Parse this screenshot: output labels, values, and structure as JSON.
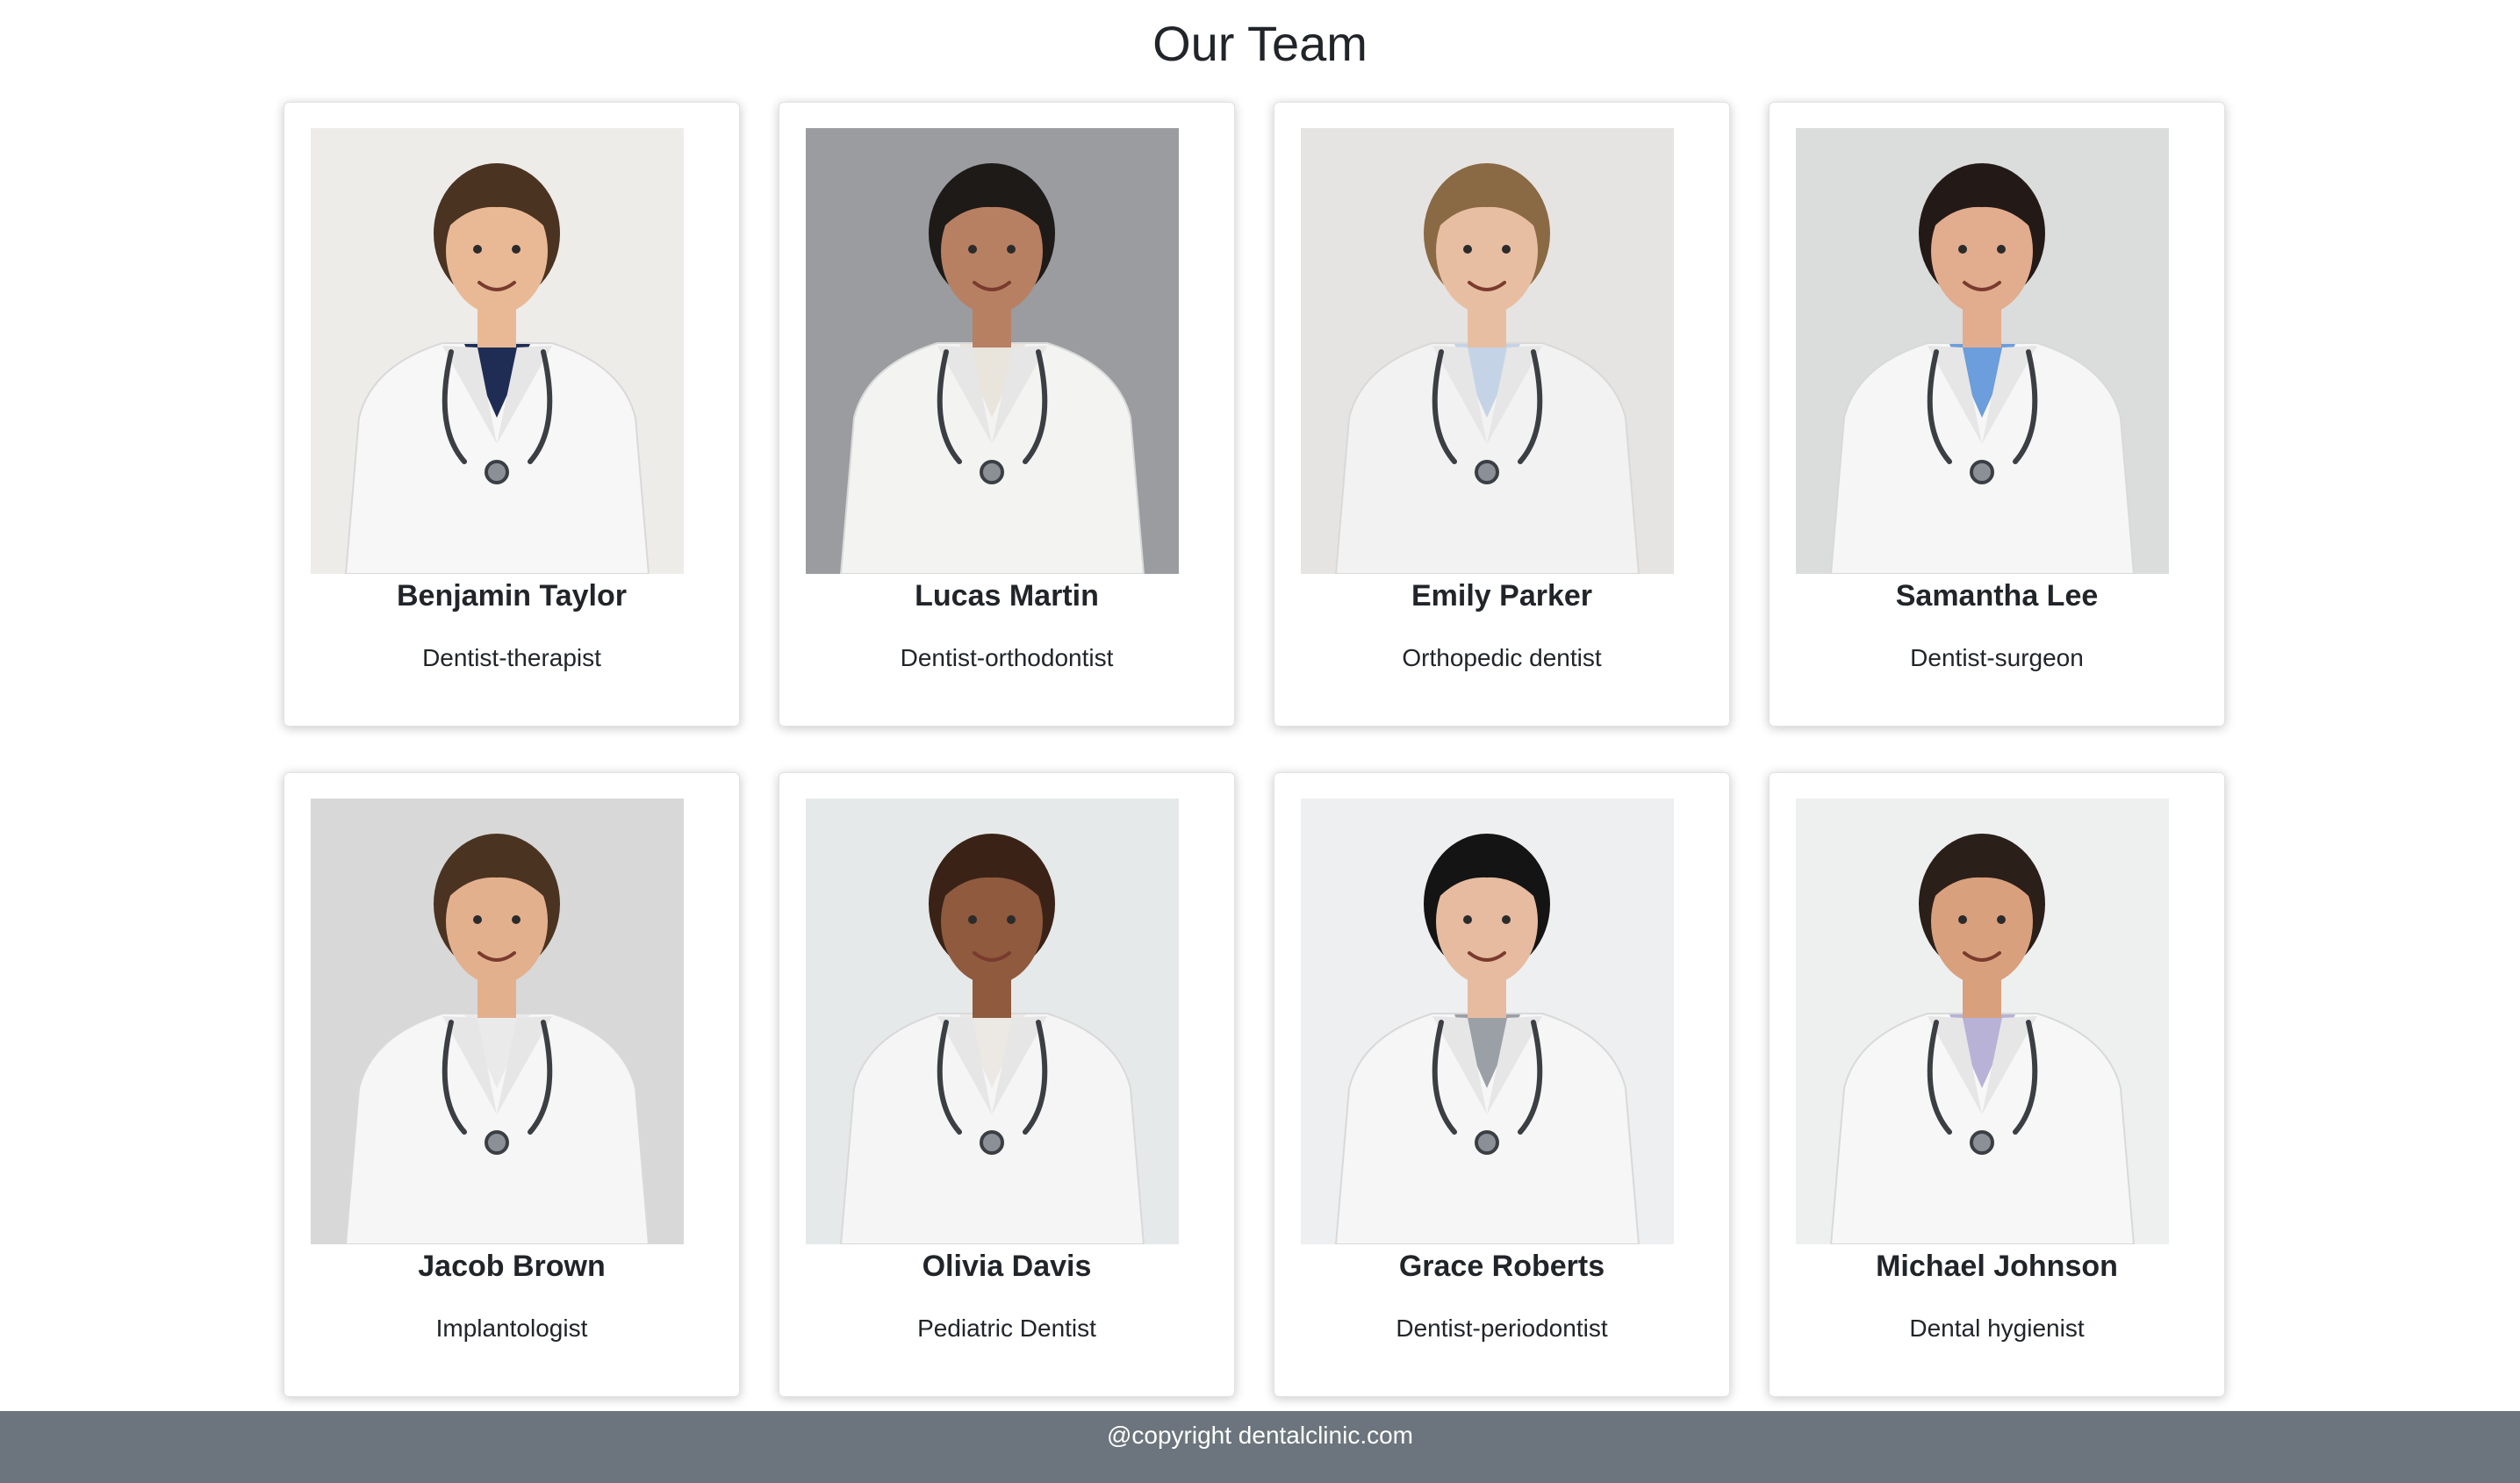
{
  "page": {
    "title": "Our Team"
  },
  "team": [
    {
      "name": "Benjamin Taylor",
      "role": "Dentist-therapist",
      "photo": "doctor-portrait-photo",
      "bg": "#eceae6",
      "skin": "#e9b996",
      "hair": "#4a3321",
      "coat": "#f7f7f7",
      "accent": "#1f2d55"
    },
    {
      "name": "Lucas Martin",
      "role": "Dentist-orthodontist",
      "photo": "doctor-portrait-photo",
      "bg": "#8c8f93",
      "skin": "#b88062",
      "hair": "#1d1a18",
      "coat": "#f3f3f1",
      "accent": "#e9e4dc"
    },
    {
      "name": "Emily Parker",
      "role": "Orthopedic dentist",
      "photo": "doctor-portrait-photo",
      "bg": "#e3e1de",
      "skin": "#e8bea2",
      "hair": "#8a6a44",
      "coat": "#f2f2f2",
      "accent": "#c5d3e6"
    },
    {
      "name": "Samantha Lee",
      "role": "Dentist-surgeon",
      "photo": "doctor-portrait-photo",
      "bg": "#d6d8d8",
      "skin": "#e2ac8e",
      "hair": "#231a17",
      "coat": "#f6f6f6",
      "accent": "#6c9ddc"
    },
    {
      "name": "Jacob Brown",
      "role": "Implantologist",
      "photo": "doctor-portrait-photo",
      "bg": "#d3d3d3",
      "skin": "#e3b08e",
      "hair": "#4b3322",
      "coat": "#f6f6f6",
      "accent": "#eaeaea"
    },
    {
      "name": "Olivia Davis",
      "role": "Pediatric Dentist",
      "photo": "doctor-portrait-photo",
      "bg": "#e2e6e8",
      "skin": "#8f5a3d",
      "hair": "#3a2217",
      "coat": "#f5f5f5",
      "accent": "#ece8e4"
    },
    {
      "name": "Grace Roberts",
      "role": "Dentist-periodontist",
      "photo": "doctor-portrait-photo",
      "bg": "#ecedee",
      "skin": "#e6bba0",
      "hair": "#141414",
      "coat": "#f6f6f6",
      "accent": "#9aa0a6"
    },
    {
      "name": "Michael Johnson",
      "role": "Dental hygienist",
      "photo": "doctor-portrait-photo",
      "bg": "#eceeee",
      "skin": "#d9a07d",
      "hair": "#2a1f19",
      "coat": "#f7f7f7",
      "accent": "#b7b2d6"
    }
  ],
  "footer": {
    "text": "@copyright dentalclinic.com"
  }
}
